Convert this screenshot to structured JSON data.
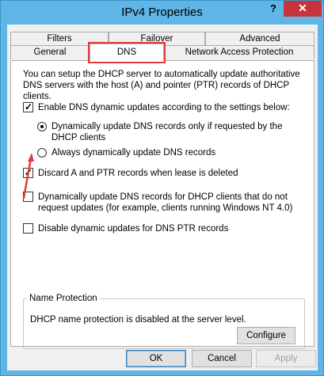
{
  "window": {
    "title": "IPv4 Properties",
    "help_glyph": "?",
    "close_glyph": "✕"
  },
  "tabs": {
    "back_row": [
      {
        "label": "Filters"
      },
      {
        "label": "Failover"
      },
      {
        "label": "Advanced"
      }
    ],
    "front_row": [
      {
        "label": "General"
      },
      {
        "label": "DNS",
        "active": true
      },
      {
        "label": "Network Access Protection"
      }
    ]
  },
  "dns": {
    "description": "You can setup the DHCP server to automatically update authoritative DNS servers with the host (A) and pointer (PTR) records of DHCP clients.",
    "enable_updates": {
      "label": "Enable DNS dynamic updates according to the settings below:",
      "checked": true
    },
    "radio_requested": {
      "label": "Dynamically update DNS records only if requested by the DHCP clients",
      "checked": true
    },
    "radio_always": {
      "label": "Always dynamically update DNS records",
      "checked": false
    },
    "discard_records": {
      "label": "Discard A and PTR records when lease is deleted",
      "checked": true
    },
    "update_non_requesting": {
      "label": "Dynamically update DNS records for DHCP clients that do not request updates (for example, clients running Windows NT 4.0)",
      "checked": false
    },
    "disable_ptr": {
      "label": "Disable dynamic updates for DNS PTR records",
      "checked": false
    },
    "name_protection": {
      "title": "Name Protection",
      "status": "DHCP name protection is disabled at the server level.",
      "configure_label": "Configure"
    }
  },
  "footer": {
    "ok_label": "OK",
    "cancel_label": "Cancel",
    "apply_label": "Apply"
  },
  "colors": {
    "titlebar": "#5eb5e6",
    "close_button": "#c7343a",
    "annotation": "#e23a3a"
  }
}
